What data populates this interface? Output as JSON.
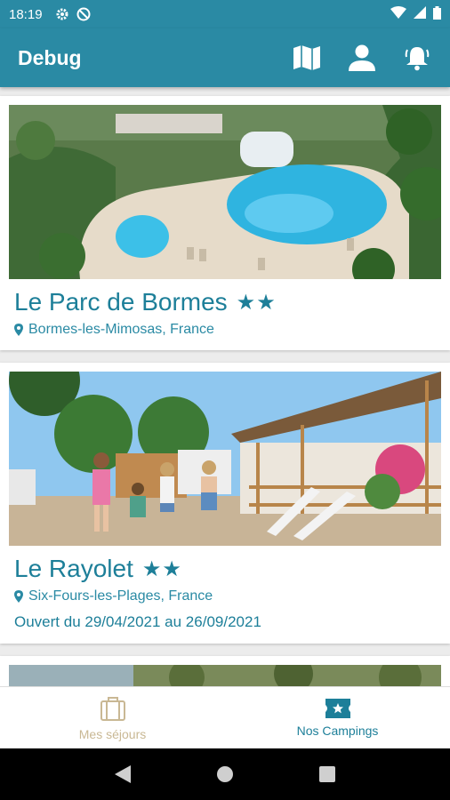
{
  "status_bar": {
    "time": "18:19"
  },
  "app_bar": {
    "title": "Debug"
  },
  "campings": [
    {
      "name": "Le Parc de Bormes",
      "stars": "★★",
      "location": "Bormes-les-Mimosas, France",
      "opening": ""
    },
    {
      "name": "Le Rayolet",
      "stars": "★★",
      "location": "Six-Fours-les-Plages, France",
      "opening": "Ouvert du 29/04/2021 au 26/09/2021"
    }
  ],
  "bottom_nav": {
    "stays_label": "Mes séjours",
    "campings_label": "Nos Campings",
    "active": "Nos Campings"
  },
  "colors": {
    "primary": "#2a8aa4",
    "text_primary": "#1d7f99",
    "inactive": "#c9b894"
  },
  "icons": [
    "settings-icon",
    "no-disturb-icon",
    "wifi-icon",
    "signal-icon",
    "battery-icon",
    "map-icon",
    "account-icon",
    "notification-bell-icon",
    "location-pin-icon",
    "suitcase-icon",
    "ticket-icon"
  ]
}
